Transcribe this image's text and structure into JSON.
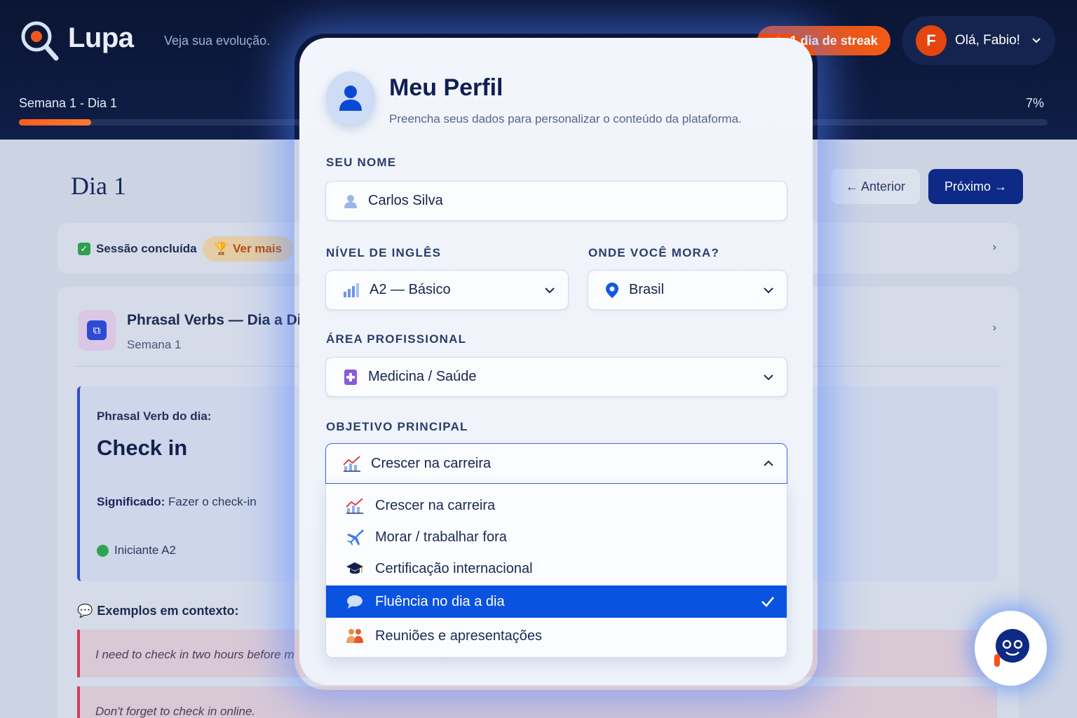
{
  "header": {
    "brand": "Lupa",
    "tagline": "Veja sua evolução.",
    "week_label": "Semana 1 - Dia 1",
    "progress_percent": 7,
    "progress_label": "7%",
    "streak_label": "1 dia de streak",
    "user_initial": "F",
    "user_greeting": "Olá, Fabio!"
  },
  "page": {
    "day_title": "Dia 1",
    "prev_label": "← Anterior",
    "next_label": "Próximo →",
    "session_status": "Sessão concluída",
    "ver_mais": "Ver mais",
    "lesson_title": "Phrasal Verbs — Dia a Di",
    "lesson_week": "Semana 1",
    "verb_label": "Phrasal Verb do dia:",
    "verb": "Check in",
    "meaning_label": "Significado:",
    "meaning_value": "Fazer o check-in",
    "level": "Iniciante A2",
    "examples_title": "Exemplos em contexto:",
    "examples": [
      "I need to check in two hours before m",
      "Don't forget to check in online."
    ]
  },
  "modal": {
    "title": "Meu Perfil",
    "subtitle": "Preencha seus dados para personalizar o conteúdo da plataforma.",
    "name_label": "SEU NOME",
    "name_value": "Carlos Silva",
    "level_label": "NÍVEL DE INGLÊS",
    "level_value": "A2 — Básico",
    "location_label": "ONDE VOCÊ MORA?",
    "location_value": "Brasil",
    "area_label": "ÁREA PROFISSIONAL",
    "area_value": "Medicina / Saúde",
    "goal_label": "OBJETIVO PRINCIPAL",
    "goal_value": "Crescer na carreira",
    "goal_options": [
      {
        "label": "Crescer na carreira",
        "icon": "chart-up-icon",
        "selected": false
      },
      {
        "label": "Morar / trabalhar fora",
        "icon": "airplane-icon",
        "selected": false
      },
      {
        "label": "Certificação internacional",
        "icon": "graduation-cap-icon",
        "selected": false
      },
      {
        "label": "Fluência no dia a dia",
        "icon": "speech-bubble-icon",
        "selected": true
      },
      {
        "label": "Reuniões e apresentações",
        "icon": "people-icon",
        "selected": false
      }
    ]
  },
  "colors": {
    "accent": "#0a52e0",
    "streak": "#e8470f",
    "navy": "#0f1f55"
  }
}
